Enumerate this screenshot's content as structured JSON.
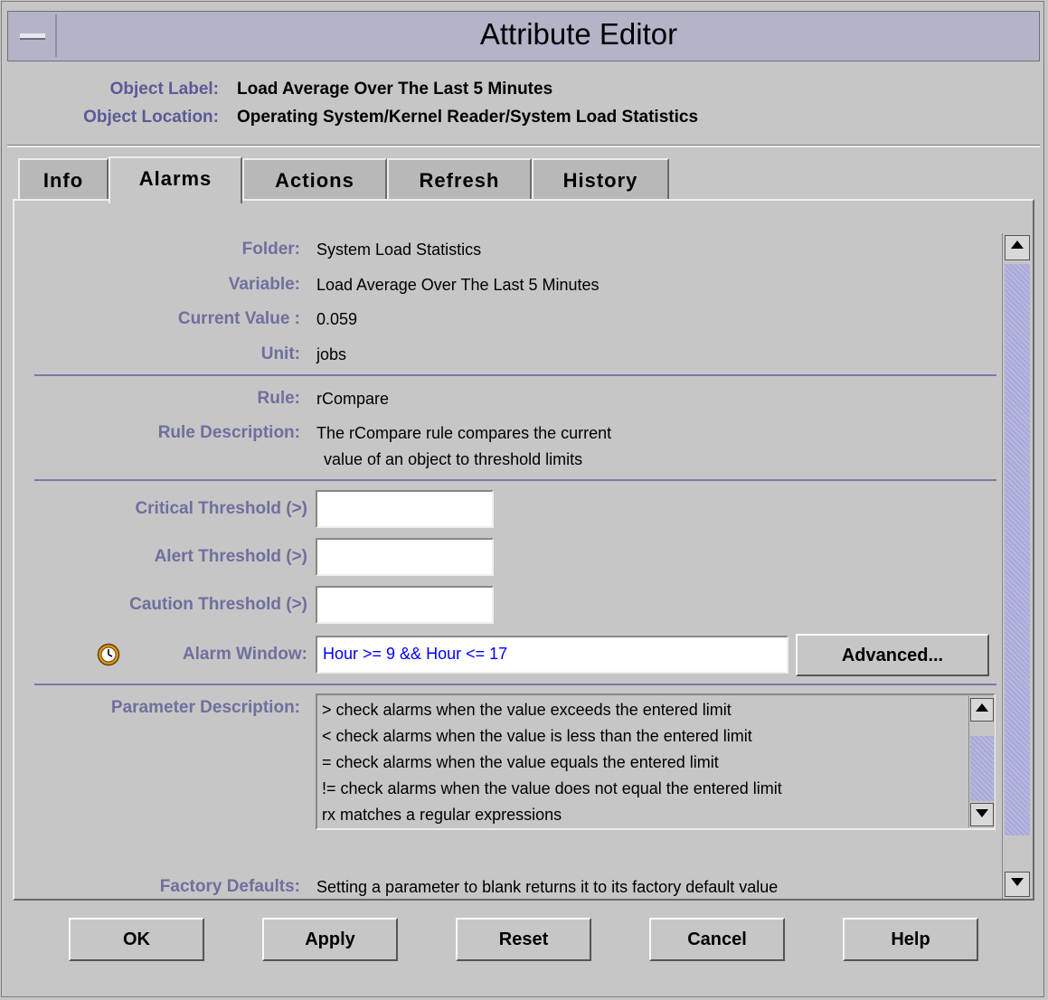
{
  "window": {
    "title": "Attribute Editor"
  },
  "header": {
    "object_label_label": "Object Label:",
    "object_label_value": "Load Average Over The Last 5 Minutes",
    "object_location_label": "Object Location:",
    "object_location_value": "Operating System/Kernel Reader/System Load Statistics"
  },
  "tabs": [
    {
      "label": "Info"
    },
    {
      "label": "Alarms"
    },
    {
      "label": "Actions"
    },
    {
      "label": "Refresh"
    },
    {
      "label": "History"
    }
  ],
  "active_tab": "Alarms",
  "alarms": {
    "folder_label": "Folder:",
    "folder_value": "System Load Statistics",
    "variable_label": "Variable:",
    "variable_value": "Load Average Over The Last 5 Minutes",
    "current_value_label": "Current Value :",
    "current_value": "0.059",
    "unit_label": "Unit:",
    "unit_value": "jobs",
    "rule_label": "Rule:",
    "rule_value": "rCompare",
    "rule_description_label": "Rule Description:",
    "rule_description_line1": "The rCompare rule compares the current",
    "rule_description_line2": "value of an object to threshold limits",
    "critical_label": "Critical Threshold (>)",
    "critical_value": "",
    "alert_label": "Alert Threshold (>)",
    "alert_value": "",
    "caution_label": "Caution Threshold (>)",
    "caution_value": "",
    "alarm_window_label": "Alarm Window:",
    "alarm_window_value": "Hour >= 9 && Hour <= 17",
    "advanced_button": "Advanced...",
    "parameter_description_label": "Parameter Description:",
    "parameter_description_lines": [
      "> check alarms when the value exceeds the entered limit",
      "< check alarms when the value is less than the entered limit",
      "= check alarms when the value equals the entered limit",
      "!= check alarms when the value does not equal the entered limit",
      "rx matches a regular expressions"
    ],
    "factory_defaults_label": "Factory Defaults:",
    "factory_defaults_value": "Setting a parameter to blank returns it to its factory default value"
  },
  "buttons": {
    "ok": "OK",
    "apply": "Apply",
    "reset": "Reset",
    "cancel": "Cancel",
    "help": "Help"
  },
  "colors": {
    "label_blue": "#6f6fa0",
    "header_label_blue": "#5a5a96",
    "scrollbar": "#a8a8d8",
    "alarm_window_text": "#0000ff"
  }
}
